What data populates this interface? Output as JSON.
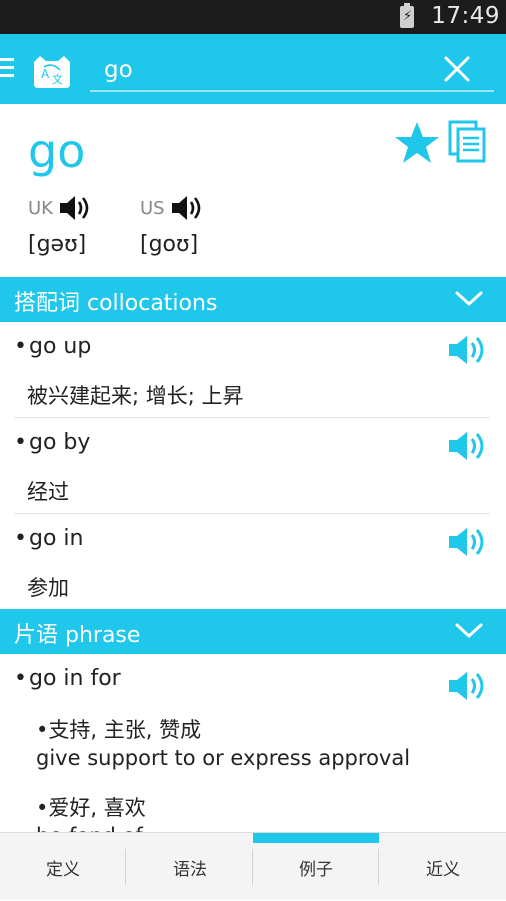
{
  "status_bar": {
    "time": "17:49"
  },
  "search": {
    "value": "go"
  },
  "entry": {
    "headword": "go",
    "uk_label": "UK",
    "us_label": "US",
    "uk_ipa": "[gəʊ]",
    "us_ipa": "[goʊ]"
  },
  "collocations": {
    "title": "搭配词 collocations",
    "items": [
      {
        "word": "go up",
        "meaning": "被兴建起来; 增长; 上昇"
      },
      {
        "word": "go by",
        "meaning": "经过"
      },
      {
        "word": "go in",
        "meaning": "参加"
      }
    ]
  },
  "phrase": {
    "title": "片语 phrase",
    "items": [
      {
        "word": "go in for",
        "senses": [
          {
            "cn": "•支持, 主张, 赞成",
            "en": "give support to or express approval"
          },
          {
            "cn": "•爱好, 喜欢",
            "en": "be fond of"
          }
        ]
      }
    ]
  },
  "bottom_nav": {
    "tabs": [
      {
        "label": "定义"
      },
      {
        "label": "语法"
      },
      {
        "label": "例子",
        "active": true
      },
      {
        "label": "近义"
      }
    ]
  },
  "colors": {
    "accent": "#1fc7ea"
  }
}
